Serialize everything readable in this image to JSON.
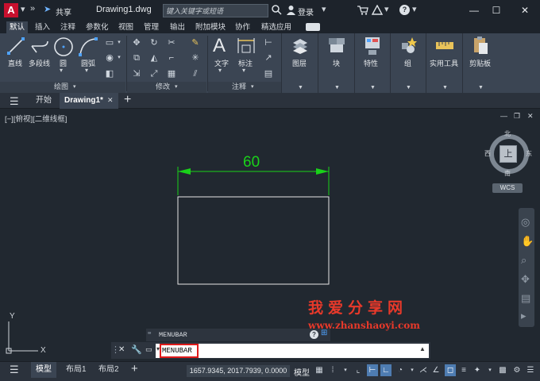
{
  "titlebar": {
    "logo": "A",
    "share": "共享",
    "document": "Drawing1.dwg",
    "search_placeholder": "键入关键字或短语",
    "login": "登录",
    "help": "?",
    "minimize": "—",
    "maximize": "☐",
    "close": "✕"
  },
  "ribbon_tabs": [
    "默认",
    "插入",
    "注释",
    "参数化",
    "视图",
    "管理",
    "输出",
    "附加模块",
    "协作",
    "精选应用"
  ],
  "ribbon": {
    "draw_tools": [
      "直线",
      "多段线",
      "圆",
      "圆弧"
    ],
    "draw_panel": "绘图",
    "modify_panel": "修改",
    "annotation_tools": [
      "文字",
      "标注"
    ],
    "annotation_panel": "注释",
    "large_panels": [
      "图层",
      "块",
      "特性",
      "组",
      "实用工具",
      "剪贴板"
    ]
  },
  "filetabs": {
    "start": "开始",
    "drawing": "Drawing1*",
    "close": "✕",
    "add": "+"
  },
  "viewport": {
    "label": "[−][俯视][二维线框]",
    "dimension": "60"
  },
  "viewcube": {
    "north": "北",
    "south": "南",
    "east": "东",
    "west": "西",
    "top": "上",
    "wcs": "WCS"
  },
  "ucs": {
    "x": "X",
    "y": "Y"
  },
  "command": {
    "history": "MENUBAR",
    "input": "MENUBAR"
  },
  "watermark": {
    "cn": "我爱分享网",
    "url": "www.zhanshaoyi.com"
  },
  "statusbar": {
    "model_tab": "模型",
    "layouts": [
      "布局1",
      "布局2"
    ],
    "add": "+",
    "coords": "1657.9345, 2017.7939, 0.0000",
    "model_label": "模型"
  },
  "colors": {
    "background": "#212830",
    "ribbon": "#3b4553",
    "dimension": "#19d219",
    "geometry": "#e6e6e6",
    "highlight": "#e01b1b"
  }
}
